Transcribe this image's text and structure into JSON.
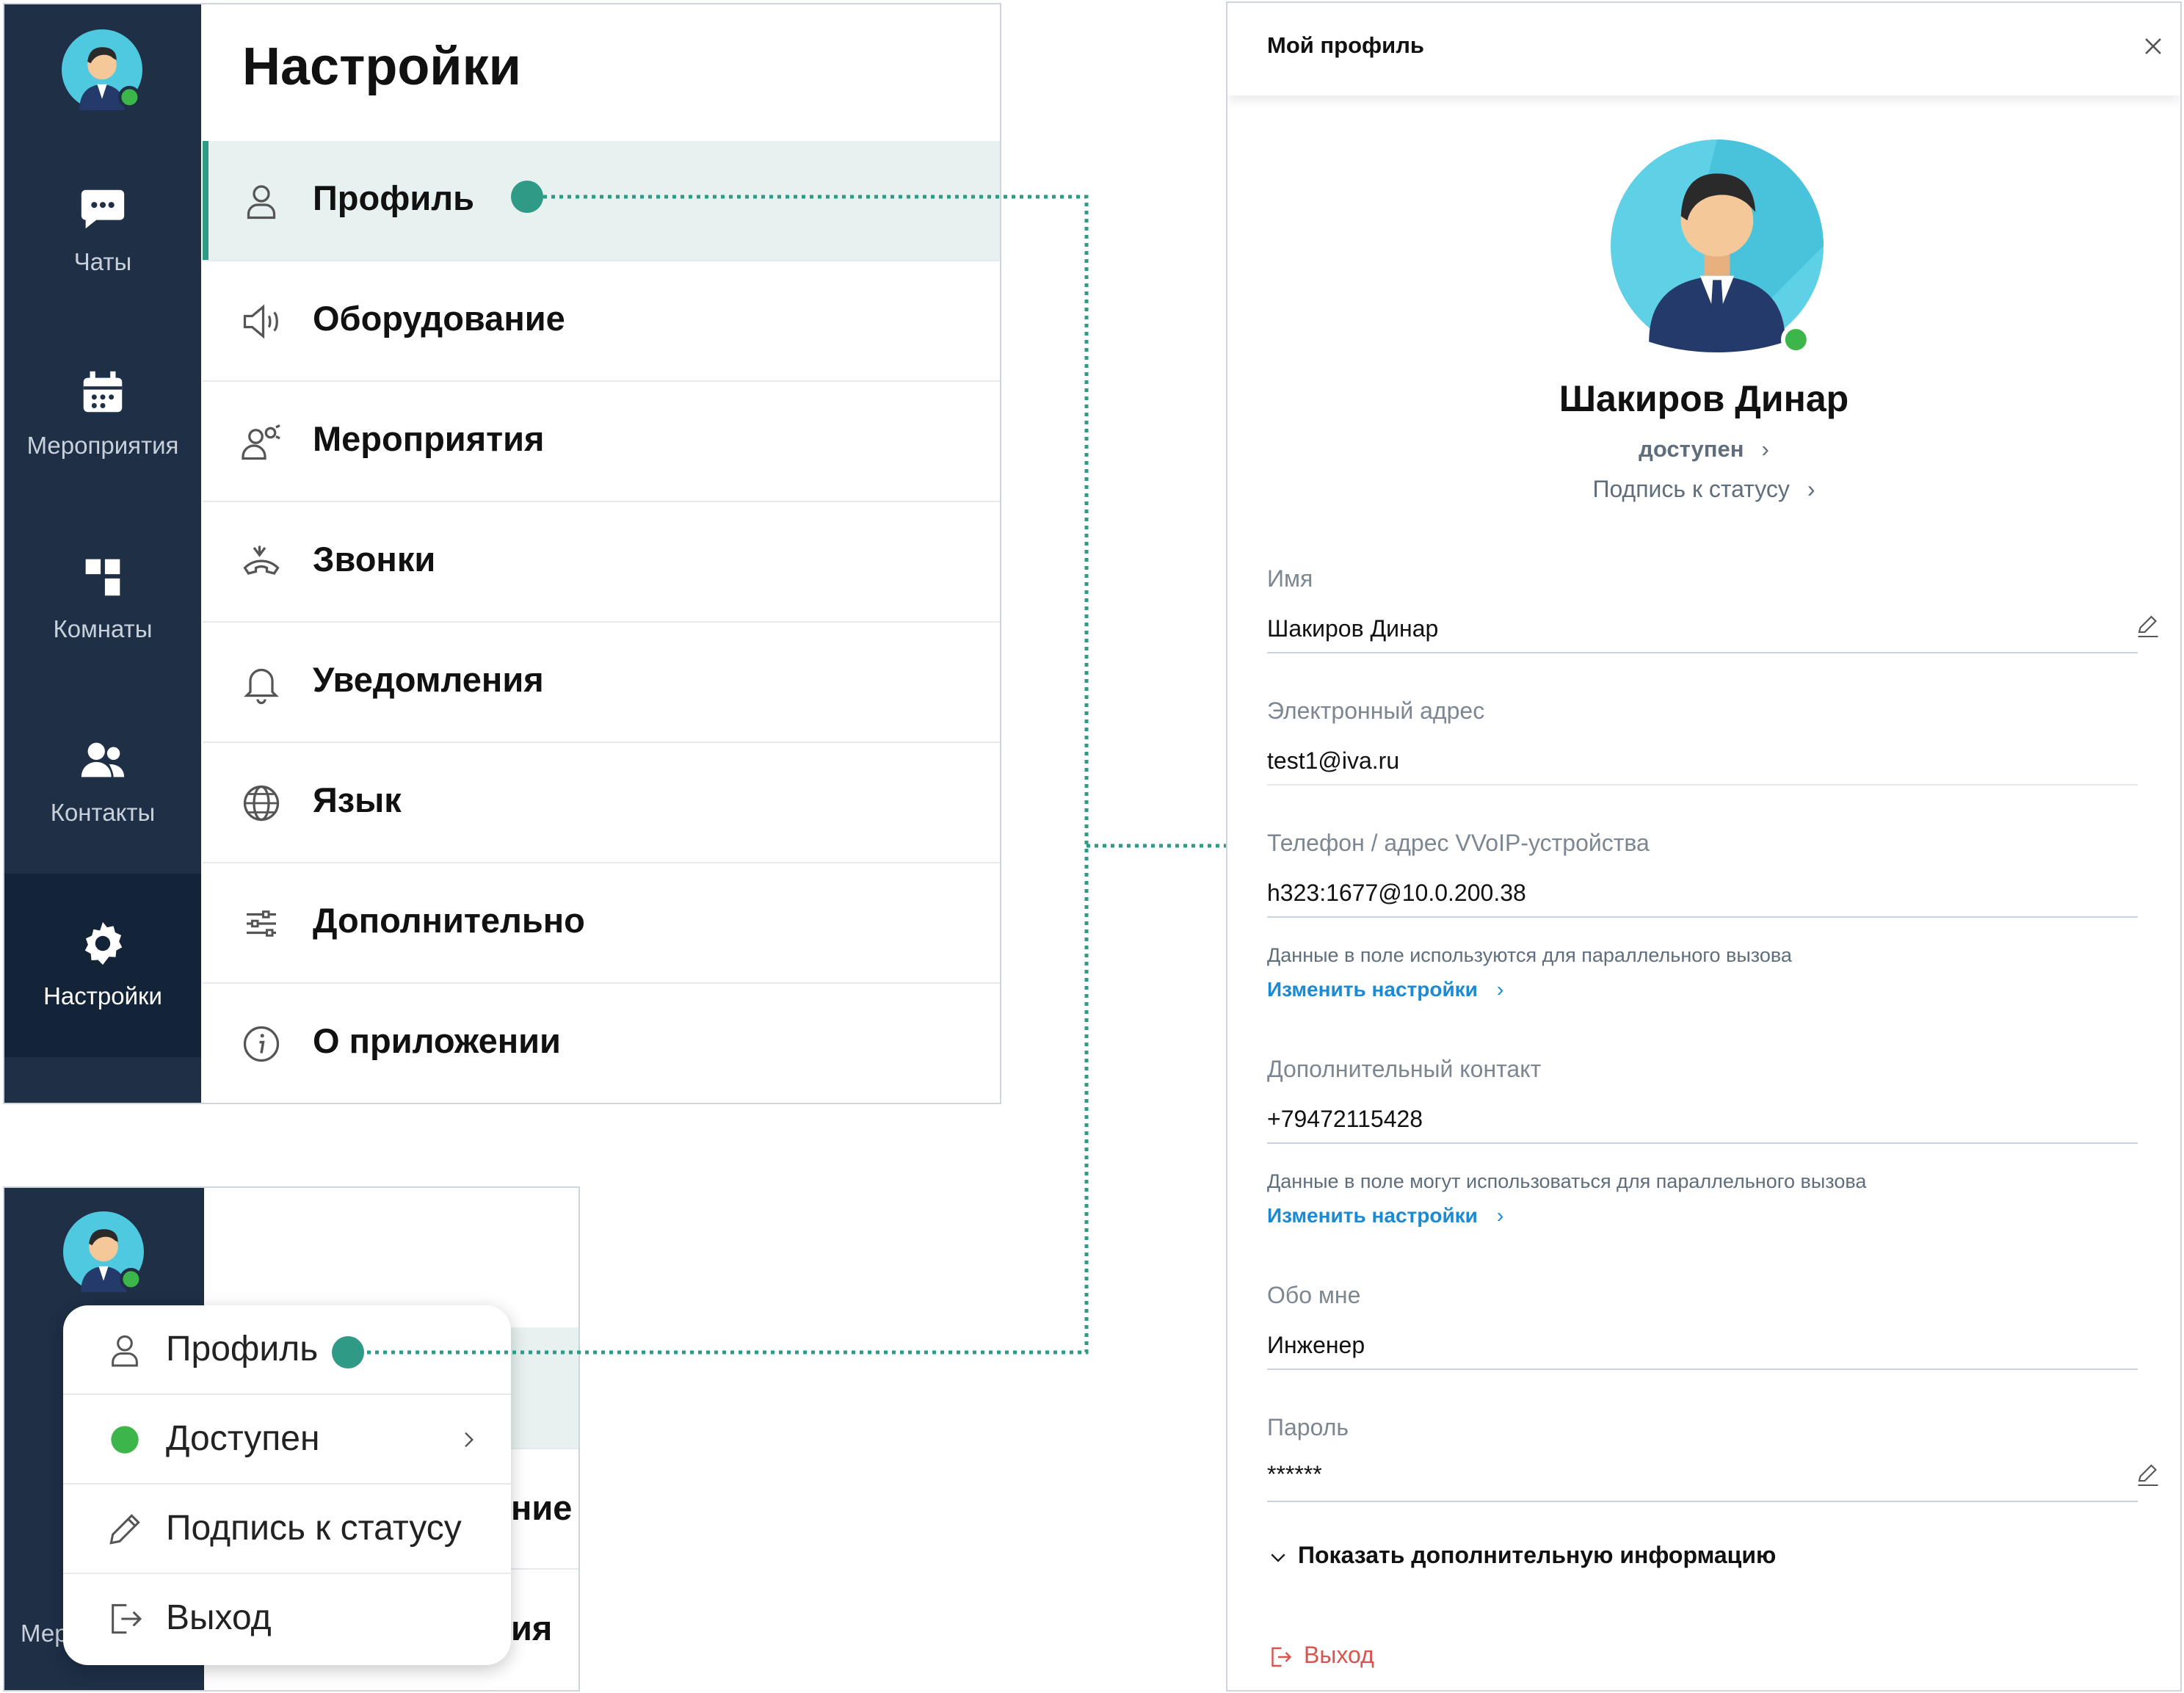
{
  "colors": {
    "sidebar_bg": "#1e2f46",
    "accent_green": "#2f9a86",
    "online_dot": "#3cb54a",
    "link_blue": "#1a8ad4",
    "logout_red": "#d9534f",
    "connector_dots": "#2f9a86"
  },
  "settings_panel": {
    "title": "Настройки",
    "sidebar": [
      {
        "label": "Чаты",
        "icon": "chat-icon"
      },
      {
        "label": "Мероприятия",
        "icon": "calendar-icon"
      },
      {
        "label": "Комнаты",
        "icon": "rooms-icon"
      },
      {
        "label": "Контакты",
        "icon": "contacts-icon"
      },
      {
        "label": "Настройки",
        "icon": "gear-icon",
        "active": true
      }
    ],
    "menu": [
      {
        "label": "Профиль",
        "icon": "person-icon",
        "active": true
      },
      {
        "label": "Оборудование",
        "icon": "speaker-icon"
      },
      {
        "label": "Мероприятия",
        "icon": "event-people-icon"
      },
      {
        "label": "Звонки",
        "icon": "phone-icon"
      },
      {
        "label": "Уведомления",
        "icon": "bell-icon"
      },
      {
        "label": "Язык",
        "icon": "globe-icon"
      },
      {
        "label": "Дополнительно",
        "icon": "sliders-icon"
      },
      {
        "label": "О приложении",
        "icon": "info-icon"
      }
    ]
  },
  "dropdown_panel": {
    "behind_text_1": "ние",
    "behind_text_2": "ия",
    "sidebar_partial": "Мер",
    "items": [
      {
        "label": "Профиль",
        "icon": "person-icon"
      },
      {
        "label": "Доступен",
        "icon": "status-dot-icon"
      },
      {
        "label": "Подпись к статусу",
        "icon": "pencil-icon"
      },
      {
        "label": "Выход",
        "icon": "logout-icon"
      }
    ]
  },
  "profile_panel": {
    "title": "Мой профиль",
    "name": "Шакиров Динар",
    "status": "доступен",
    "status_signature": "Подпись к статусу",
    "fields": {
      "name_label": "Имя",
      "name_value": "Шакиров Динар",
      "email_label": "Электронный адрес",
      "email_value": "test1@iva.ru",
      "phone_label": "Телефон / адрес VVoIP-устройства",
      "phone_value": "h323:1677@10.0.200.38",
      "phone_hint": "Данные в поле используются для параллельного вызова",
      "phone_link": "Изменить настройки",
      "extra_label": "Дополнительный контакт",
      "extra_value": "+79472115428",
      "extra_hint": "Данные в поле могут использоваться для параллельного вызова",
      "extra_link": "Изменить настройки",
      "about_label": "Обо мне",
      "about_value": "Инженер",
      "password_label": "Пароль",
      "password_value": "******"
    },
    "show_more": "Показать дополнительную информацию",
    "logout": "Выход"
  }
}
